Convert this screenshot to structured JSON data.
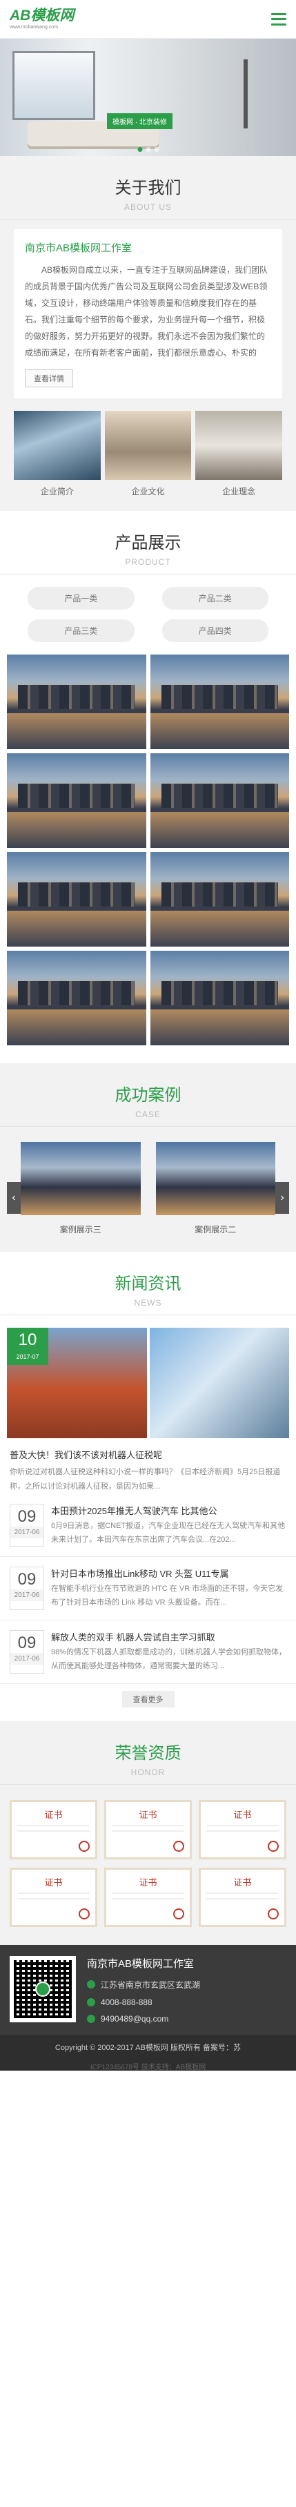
{
  "header": {
    "logo": "AB模板网",
    "logo_sub": "www.mobanwang.com"
  },
  "banner": {
    "tag": "模板网 · 北京装修"
  },
  "about": {
    "title": "关于我们",
    "subtitle": "ABOUT US",
    "company": "南京市AB模板网工作室",
    "text": "AB模板网自成立以来，一直专注于互联网品牌建设，我们团队的成员背景于国内优秀广告公司及互联网公司会员类型涉及WEB领域，交互设计，移动终端用户体验等质量和信赖度我们存在的基石。我们注重每个细节的每个要求，为业务提升每一个细节，积极的做好服务，努力开拓更好的视野。我们永远不会因为我们繁忙的成绩而满足，在所有新老客户面前，我们都很乐意虚心、朴实的",
    "more": "查看详情",
    "cards": [
      "企业简介",
      "企业文化",
      "企业理念"
    ]
  },
  "products": {
    "title": "产品展示",
    "subtitle": "PRODUCT",
    "categories": [
      "产品一类",
      "产品二类",
      "产品三类",
      "产品四类"
    ]
  },
  "cases": {
    "title": "成功案例",
    "subtitle": "CASE",
    "items": [
      "案例展示三",
      "案例展示二"
    ]
  },
  "news": {
    "title": "新闻资讯",
    "subtitle": "NEWS",
    "featured": {
      "day": "10",
      "month": "2017-07",
      "title": "普及大快！我们该不该对机器人征税呢",
      "text": "你听说过对机器人征税这种科幻小说一样的事吗？《日本经济新闻》5月25日报道称，之所以讨论对机器人征税，是因为如果..."
    },
    "items": [
      {
        "day": "09",
        "month": "2017-06",
        "title": "本田预计2025年推无人驾驶汽车 比其他公",
        "text": "6月9日消息，据CNET报道，汽车企业现在已经在无人驾驶汽车和其他未来计划了。本田汽车在东京出席了汽车会议...在202..."
      },
      {
        "day": "09",
        "month": "2017-06",
        "title": "针对日本市场推出Link移动 VR 头盔 U11专属",
        "text": "在智能手机行业在节节败退的 HTC 在 VR 市场面的还不错，今天它发布了针对日本市场的 Link 移动 VR 头戴设备。而在..."
      },
      {
        "day": "09",
        "month": "2017-06",
        "title": "解放人类的双手 机器人尝试自主学习抓取",
        "text": "98%的情况下机器人抓取都是成功的，训练机器人学会如何抓取物体，从而使其能够处理各种物体，通常需要大量的练习..."
      }
    ],
    "more": "查看更多"
  },
  "honor": {
    "title": "荣誉资质",
    "subtitle": "HONOR",
    "cert_title": "证书"
  },
  "footer": {
    "company": "南京市AB模板网工作室",
    "address": "江苏省南京市玄武区玄武湖",
    "phone": "4008-888-888",
    "email": "9490489@qq.com",
    "copyright": "Copyright © 2002-2017 AB模板网 版权所有 备案号：苏",
    "icp": "ICP12345678号 技术支持：AB模板网"
  }
}
